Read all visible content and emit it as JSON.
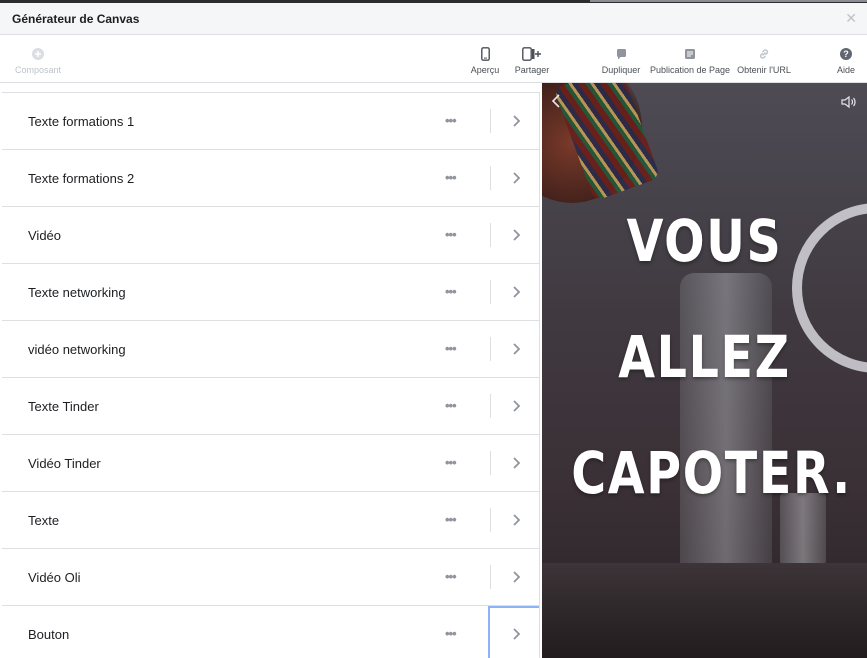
{
  "window": {
    "title": "Générateur de Canvas"
  },
  "toolbar": {
    "component_label": "Composant",
    "preview_label": "Aperçu",
    "share_label": "Partager",
    "duplicate_label": "Dupliquer",
    "publish_label": "Publication de Page",
    "get_url_label": "Obtenir l'URL",
    "help_label": "Aide"
  },
  "components": [
    {
      "label": "Texte formations 1"
    },
    {
      "label": "Texte formations 2"
    },
    {
      "label": "Vidéo"
    },
    {
      "label": "Texte networking"
    },
    {
      "label": "vidéo networking"
    },
    {
      "label": "Texte Tinder"
    },
    {
      "label": "Vidéo Tinder"
    },
    {
      "label": "Texte"
    },
    {
      "label": "Vidéo Oli"
    },
    {
      "label": "Bouton"
    }
  ],
  "preview": {
    "headline_lines": [
      "VOUS",
      "ALLEZ",
      "CAPOTER."
    ]
  },
  "colors": {
    "accent": "#8ab4f8",
    "border": "#dddfe2",
    "muted_text": "#90949c"
  }
}
